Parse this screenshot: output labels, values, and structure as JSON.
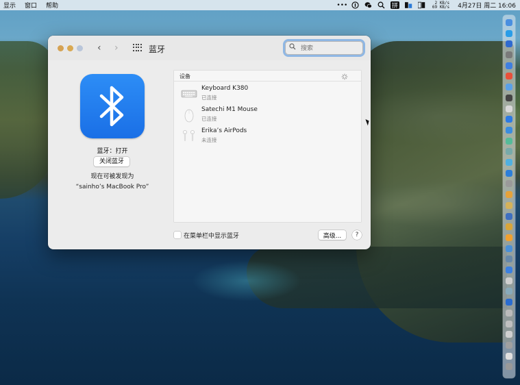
{
  "menubar": {
    "items": [
      "显示",
      "窗口",
      "帮助"
    ],
    "net_up": "2 KB/s",
    "net_down": "69 KB/s",
    "input_method": "拼",
    "clock": "4月27日 周二  16:06"
  },
  "window": {
    "title": "蓝牙",
    "search_placeholder": "搜索",
    "back_glyph": "‹",
    "forward_glyph": "›"
  },
  "bluetooth": {
    "status": "蓝牙：打开",
    "toggle_label": "关闭蓝牙",
    "discoverable_label": "现在可被发现为",
    "computer_name": "“sainho’s MacBook Pro”",
    "tile_color": "#1f7ef0"
  },
  "devices": {
    "header": "设备",
    "items": [
      {
        "name": "Keyboard K380",
        "status": "已连接",
        "icon": "keyboard-icon"
      },
      {
        "name": "Satechi M1 Mouse",
        "status": "已连接",
        "icon": "mouse-icon"
      },
      {
        "name": "Erika’s AirPods",
        "status": "未连接",
        "icon": "airpods-icon"
      }
    ]
  },
  "footer": {
    "show_in_menubar_label": "在菜单栏中显示蓝牙",
    "advanced_label": "高级...",
    "help_label": "?"
  },
  "dock": {
    "colors": [
      "#4a8fe0",
      "#2a9de8",
      "#2f6ad0",
      "#7a7a7a",
      "#3f7fe0",
      "#e8503a",
      "#5aa0e8",
      "#444",
      "#d8d8d8",
      "#2c7be5",
      "#3a8ddf",
      "#5b9",
      "#7aa",
      "#50b0e0",
      "#2d7fd9",
      "#9a9a9a",
      "#e5a23a",
      "#d4b25a",
      "#3e6fc0",
      "#d8a53a",
      "#f0a030",
      "#4a90d8",
      "#68a",
      "#3b80e0",
      "#cfcfcf",
      "#8ab",
      "#2a6cd0",
      "#bbb",
      "#c0c0c0",
      "#d0d0d0",
      "#a0a0a0",
      "#e0e0e0",
      "#999"
    ]
  }
}
